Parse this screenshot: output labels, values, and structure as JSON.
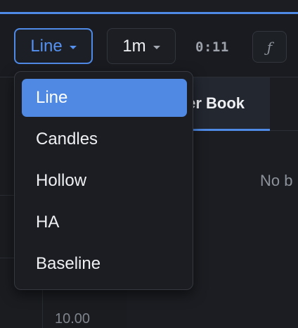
{
  "toolbar": {
    "chart_type_label": "Line",
    "interval_label": "1m",
    "timer": "0:11",
    "fx_label": "ƒ"
  },
  "dropdown": {
    "items": [
      {
        "label": "Line",
        "selected": true
      },
      {
        "label": "Candles",
        "selected": false
      },
      {
        "label": "Hollow",
        "selected": false
      },
      {
        "label": "HA",
        "selected": false
      },
      {
        "label": "Baseline",
        "selected": false
      }
    ]
  },
  "panel": {
    "tab_label": "Order Book",
    "empty_message": "No b"
  },
  "chart": {
    "price_label": "10.00"
  },
  "colors": {
    "accent": "#4f8ae6",
    "background": "#191b20"
  }
}
